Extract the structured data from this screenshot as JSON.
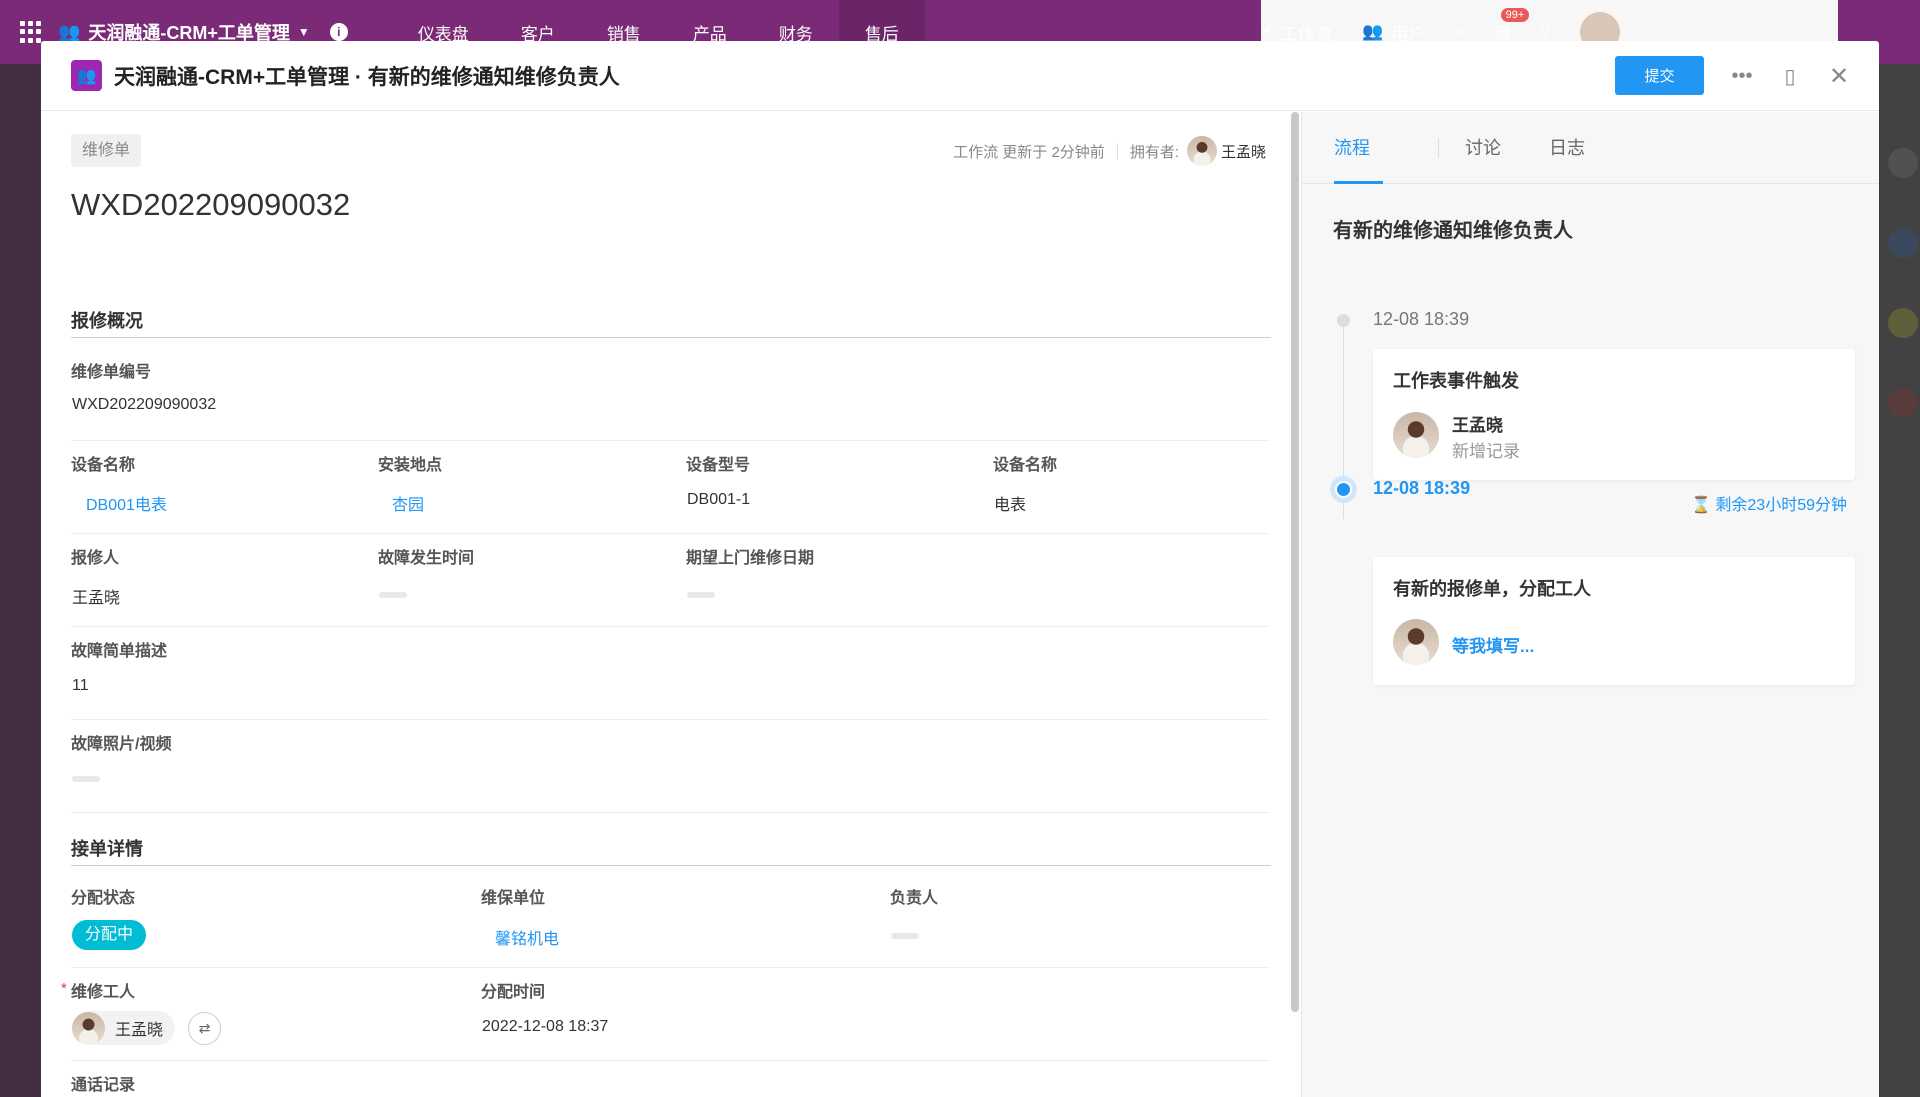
{
  "app": {
    "title": "天润融通-CRM+工单管理",
    "nav": [
      "仪表盘",
      "客户",
      "销售",
      "产品",
      "财务",
      "售后"
    ],
    "active_nav": "售后",
    "right_items": {
      "workflow": "工作流",
      "users": "用户"
    },
    "notification_badge": "99+"
  },
  "modal": {
    "title": "天润融通-CRM+工单管理 · 有新的维修通知维修负责人",
    "submit_label": "提交",
    "record_type": "维修单",
    "record_no": "WXD202209090032",
    "meta": {
      "workflow_updated": "工作流 更新于 2分钟前",
      "owner_label": "拥有者:",
      "owner_name": "王孟晓"
    }
  },
  "sections": {
    "overview_title": "报修概况",
    "order_title": "接单详情"
  },
  "fields": {
    "repair_no": {
      "label": "维修单编号",
      "value": "WXD202209090032"
    },
    "device_name": {
      "label": "设备名称",
      "value": "DB001电表"
    },
    "install_location": {
      "label": "安装地点",
      "value": "杏园"
    },
    "device_model": {
      "label": "设备型号",
      "value": "DB001-1"
    },
    "device_name2": {
      "label": "设备名称",
      "value": "电表"
    },
    "reporter": {
      "label": "报修人",
      "value": "王孟晓"
    },
    "fault_time": {
      "label": "故障发生时间",
      "value": ""
    },
    "expected_date": {
      "label": "期望上门维修日期",
      "value": ""
    },
    "fault_desc": {
      "label": "故障简单描述",
      "value": "11"
    },
    "fault_media": {
      "label": "故障照片/视频",
      "value": ""
    },
    "assign_status": {
      "label": "分配状态",
      "value": "分配中"
    },
    "maintenance_unit": {
      "label": "维保单位",
      "value": "馨铭机电"
    },
    "responsible": {
      "label": "负责人",
      "value": ""
    },
    "repair_worker": {
      "label": "维修工人",
      "value": "王孟晓",
      "required_mark": "*"
    },
    "assign_time": {
      "label": "分配时间",
      "value": "2022-12-08 18:37"
    },
    "call_records": {
      "label": "通话记录",
      "value": ""
    }
  },
  "panel": {
    "tabs": [
      "流程",
      "讨论",
      "日志"
    ],
    "active_tab": "流程",
    "flow_title": "有新的维修通知维修负责人",
    "steps": [
      {
        "time": "12-08 18:39",
        "title": "工作表事件触发",
        "user": "王孟晓",
        "action": "新增记录"
      },
      {
        "time": "12-08 18:39",
        "remaining": "剩余23小时59分钟",
        "title": "有新的报修单，分配工人",
        "action": "等我填写..."
      }
    ]
  },
  "colors": {
    "accent": "#2196f3",
    "topbar": "#7b2a78",
    "status_pill": "#00bcd4",
    "app_logo": "#9c27b0"
  }
}
